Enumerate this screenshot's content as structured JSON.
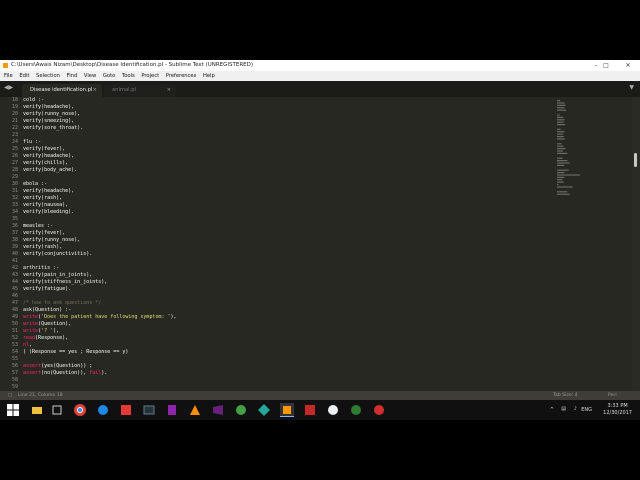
{
  "window": {
    "title": "C:\\Users\\Awais Nizam\\Desktop\\Disease Identification.pl - Sublime Text (UNREGISTERED)"
  },
  "menu": [
    "File",
    "Edit",
    "Selection",
    "Find",
    "View",
    "Goto",
    "Tools",
    "Project",
    "Preferences",
    "Help"
  ],
  "tabs": [
    {
      "label": "Disease identification.pl",
      "active": true
    },
    {
      "label": "animal.pl",
      "active": false
    }
  ],
  "editor": {
    "lines": [
      {
        "n": "18",
        "t": "cold :-"
      },
      {
        "n": "19",
        "t": "verify(headache),"
      },
      {
        "n": "20",
        "t": "verify(runny_nose),"
      },
      {
        "n": "21",
        "t": "verify(sneezing),"
      },
      {
        "n": "22",
        "t": "verify(sore_throat)."
      },
      {
        "n": "23",
        "t": ""
      },
      {
        "n": "24",
        "t": "flu :-"
      },
      {
        "n": "25",
        "t": "verify(fever),"
      },
      {
        "n": "26",
        "t": "verify(headache),"
      },
      {
        "n": "27",
        "t": "verify(chills),"
      },
      {
        "n": "28",
        "t": "verify(body_ache)."
      },
      {
        "n": "29",
        "t": ""
      },
      {
        "n": "30",
        "t": "ebola :-"
      },
      {
        "n": "31",
        "t": "verify(headache),"
      },
      {
        "n": "32",
        "t": "verify(rash),"
      },
      {
        "n": "33",
        "t": "verify(nausea),"
      },
      {
        "n": "34",
        "t": "verify(bleeding)."
      },
      {
        "n": "35",
        "t": ""
      },
      {
        "n": "36",
        "t": "measles :-"
      },
      {
        "n": "37",
        "t": "verify(fever),"
      },
      {
        "n": "38",
        "t": "verify(runny_nose),"
      },
      {
        "n": "39",
        "t": "verify(rash),"
      },
      {
        "n": "40",
        "t": "verify(conjunctivitis)."
      },
      {
        "n": "41",
        "t": ""
      },
      {
        "n": "42",
        "t": "arthritis :-"
      },
      {
        "n": "43",
        "t": "verify(pain_in_joints),"
      },
      {
        "n": "44",
        "t": "verify(stiffness_in_joints),"
      },
      {
        "n": "45",
        "t": "verify(fatigue)."
      },
      {
        "n": "46",
        "t": ""
      },
      {
        "n": "47",
        "t": "/* how to ask questions */"
      },
      {
        "n": "48",
        "t": "ask(Question) :-"
      },
      {
        "n": "49",
        "t": "write('Does the patient have following symptom: '),"
      },
      {
        "n": "50",
        "t": "write(Question),"
      },
      {
        "n": "51",
        "t": "write('? '),"
      },
      {
        "n": "52",
        "t": "read(Response),"
      },
      {
        "n": "53",
        "t": "nl,"
      },
      {
        "n": "54",
        "t": "( (Response == yes ; Response == y)"
      },
      {
        "n": "55",
        "t": ""
      },
      {
        "n": "56",
        "t": "assert(yes(Question)) ;"
      },
      {
        "n": "57",
        "t": "assert(no(Question)), fail)."
      },
      {
        "n": "58",
        "t": ""
      },
      {
        "n": "59",
        "t": ""
      }
    ]
  },
  "status": {
    "position": "Line 21, Column 18",
    "tab_size": "Tab Size: 4",
    "syntax": "Perl"
  },
  "taskbar": {
    "language": "ENG",
    "time": "3:33 PM",
    "date": "12/30/2017"
  }
}
